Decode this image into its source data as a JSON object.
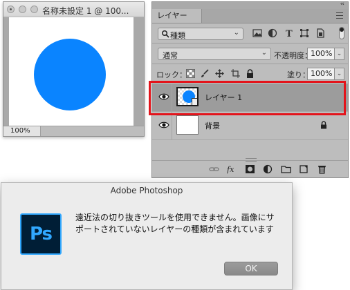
{
  "document": {
    "title": "名称未設定 1 @ 100...",
    "zoom": "100%",
    "circle_color": "#0a84ff"
  },
  "layers_panel": {
    "collapse_icon": "double-chevron-icon",
    "tab_label": "レイヤー",
    "filter_kind": "種類",
    "blend_mode": "通常",
    "opacity_label": "不透明度：",
    "opacity_value": "100%",
    "lock_label": "ロック：",
    "fill_label": "塗り：",
    "fill_value": "100%",
    "layers": [
      {
        "name": "レイヤー 1",
        "visible": true,
        "selected": true,
        "type": "smart-object"
      },
      {
        "name": "背景",
        "visible": true,
        "selected": false,
        "locked": true
      }
    ],
    "highlight_color": "#e3141b"
  },
  "dialog": {
    "title": "Adobe Photoshop",
    "app_logo_text": "Ps",
    "message_line1": "遠近法の切り抜きツールを使用できません。画像にサ",
    "message_line2": "ポートされていないレイヤーの種類が含まれています",
    "ok_label": "OK"
  }
}
